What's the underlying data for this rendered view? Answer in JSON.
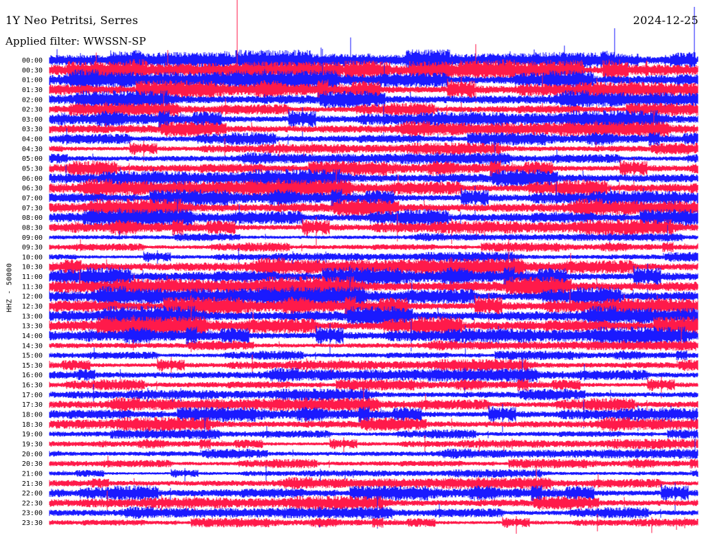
{
  "header": {
    "station": "1Y Neo Petritsi, Serres",
    "date": "2024-12-25",
    "filter": "Applied filter: WWSSN-SP"
  },
  "axis": {
    "label": "HHZ - 50000"
  },
  "colors": {
    "series_a": "#1a1aff",
    "series_b": "#ff1a4a",
    "background": "#ffffff"
  },
  "chart_data": {
    "type": "line",
    "title": "1Y Neo Petritsi, Serres",
    "ylabel": "HHZ - 50000",
    "time_labels": [
      "00:00",
      "00:30",
      "01:00",
      "01:30",
      "02:00",
      "02:30",
      "03:00",
      "03:30",
      "04:00",
      "04:30",
      "05:00",
      "05:30",
      "06:00",
      "06:30",
      "07:00",
      "07:30",
      "08:00",
      "08:30",
      "09:00",
      "09:30",
      "10:00",
      "10:30",
      "11:00",
      "11:30",
      "12:00",
      "12:30",
      "13:00",
      "13:30",
      "14:00",
      "14:30",
      "15:00",
      "15:30",
      "16:00",
      "16:30",
      "17:00",
      "17:30",
      "18:00",
      "18:30",
      "19:00",
      "19:30",
      "20:00",
      "20:30",
      "21:00",
      "21:30",
      "22:00",
      "22:30",
      "23:00",
      "23:30"
    ],
    "trace_colors": [
      "#1a1aff",
      "#ff1a4a"
    ],
    "relative_amplitude": [
      1.0,
      1.0,
      1.0,
      1.0,
      0.9,
      0.7,
      0.9,
      0.8,
      0.7,
      0.6,
      0.6,
      0.8,
      0.9,
      0.9,
      0.9,
      0.9,
      0.9,
      0.8,
      0.4,
      0.5,
      0.5,
      0.9,
      1.0,
      1.0,
      1.0,
      1.0,
      1.0,
      1.0,
      0.9,
      0.5,
      0.5,
      0.6,
      0.7,
      0.6,
      0.6,
      0.7,
      0.8,
      0.7,
      0.5,
      0.5,
      0.5,
      0.5,
      0.4,
      0.6,
      0.8,
      0.7,
      0.6,
      0.5
    ]
  }
}
